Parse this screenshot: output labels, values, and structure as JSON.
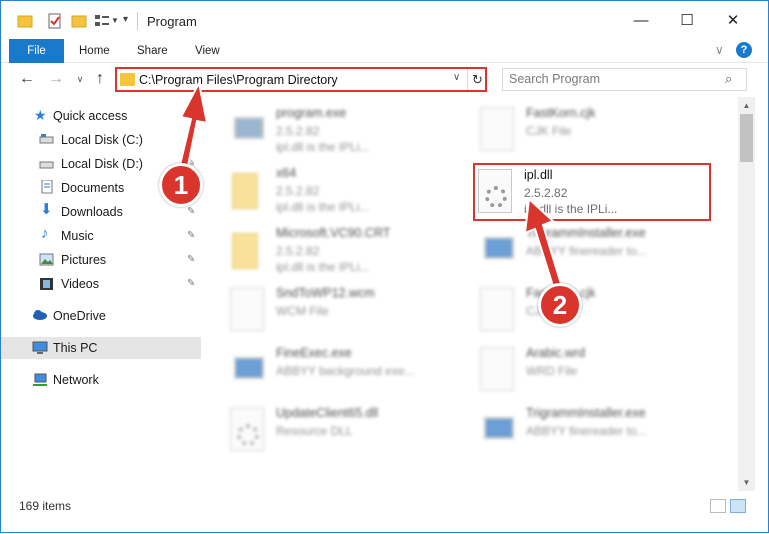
{
  "window": {
    "title": "Program",
    "controls": {
      "minimize": "—",
      "maximize": "☐",
      "close": "✕"
    }
  },
  "ribbon": {
    "tabs": [
      "File",
      "Home",
      "Share",
      "View"
    ],
    "help": "?"
  },
  "address": {
    "path": "C:\\Program Files\\Program Directory",
    "search_placeholder": "Search Program"
  },
  "nav": {
    "items": [
      {
        "label": "Quick access",
        "icon": "star-icon",
        "pinned": false
      },
      {
        "label": "Local Disk (C:)",
        "icon": "drive-icon",
        "pinned": false
      },
      {
        "label": "Local Disk (D:)",
        "icon": "drive-icon",
        "pinned": true
      },
      {
        "label": "Documents",
        "icon": "documents-icon",
        "pinned": true
      },
      {
        "label": "Downloads",
        "icon": "download-icon",
        "pinned": true
      },
      {
        "label": "Music",
        "icon": "music-icon",
        "pinned": true
      },
      {
        "label": "Pictures",
        "icon": "pictures-icon",
        "pinned": true
      },
      {
        "label": "Videos",
        "icon": "videos-icon",
        "pinned": true
      },
      {
        "label": "OneDrive",
        "icon": "cloud-icon",
        "pinned": false
      },
      {
        "label": "This PC",
        "icon": "computer-icon",
        "pinned": false,
        "selected": true
      },
      {
        "label": "Network",
        "icon": "network-icon",
        "pinned": false
      }
    ]
  },
  "files": [
    {
      "name": "program.exe",
      "meta1": "2.5.2.82",
      "meta2": "ipl.dll is the IPLi...",
      "kind": "exe"
    },
    {
      "name": "FastKorn.cjk",
      "meta1": "CJK File",
      "meta2": "",
      "kind": "doc"
    },
    {
      "name": "x64",
      "meta1": "2.5.2.82",
      "meta2": "ipl.dll is the IPLi...",
      "kind": "folder"
    },
    {
      "name": "ipl.dll",
      "meta1": "2.5.2.82",
      "meta2": "ipl.dll is the IPLi...",
      "kind": "dll"
    },
    {
      "name": "Microsoft.VC90.CRT",
      "meta1": "2.5.2.82",
      "meta2": "ipl.dll is the IPLi...",
      "kind": "folder"
    },
    {
      "name": "TrigrammInstaller.exe",
      "meta1": "ABBYY finereader to...",
      "meta2": "",
      "kind": "exe"
    },
    {
      "name": "SndToWP12.wcm",
      "meta1": "WCM File",
      "meta2": "",
      "kind": "doc"
    },
    {
      "name": "FastKorn.cjk",
      "meta1": "CJK File",
      "meta2": "",
      "kind": "doc"
    },
    {
      "name": "FineExec.exe",
      "meta1": "ABBYY background exe...",
      "meta2": "",
      "kind": "exe"
    },
    {
      "name": "Arabic.wrd",
      "meta1": "WRD File",
      "meta2": "",
      "kind": "doc"
    },
    {
      "name": "UpdateClient65.dll",
      "meta1": "Resource DLL",
      "meta2": "",
      "kind": "dll"
    },
    {
      "name": "TrigrammInstaller.exe",
      "meta1": "ABBYY finereader to...",
      "meta2": "",
      "kind": "exe"
    }
  ],
  "status": {
    "items_count": "169 items"
  },
  "callouts": {
    "one": "1",
    "two": "2"
  },
  "colors": {
    "accent": "#1979ca",
    "highlight": "#d9352c"
  }
}
